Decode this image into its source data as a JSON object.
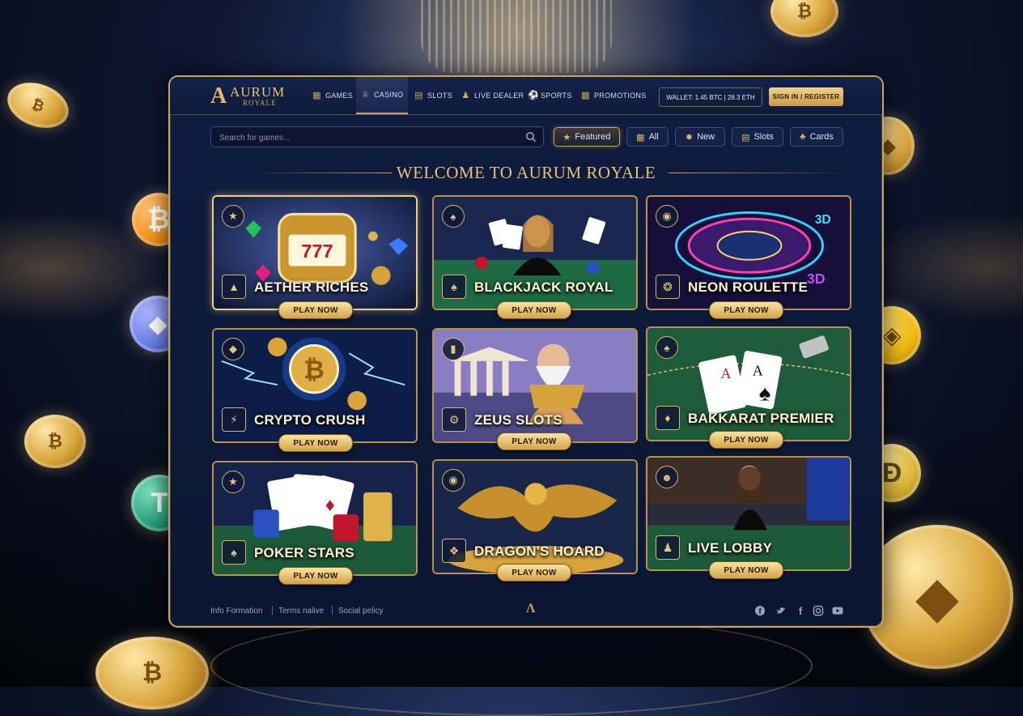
{
  "header": {
    "logo_mark": "A",
    "logo_name": "AURUM",
    "logo_sub": "ROYALE",
    "nav": [
      {
        "label": "GAMES",
        "icon": "grid-icon"
      },
      {
        "label": "CASINO",
        "icon": "crown-icon",
        "active": true
      },
      {
        "label": "SLOTS",
        "icon": "slot-machine-icon"
      },
      {
        "label": "LIVE DEALER",
        "icon": "person-icon"
      },
      {
        "label": "SPORTS",
        "icon": "soccer-ball-icon"
      },
      {
        "label": "PROMOTIONS",
        "icon": "gift-icon"
      }
    ],
    "wallet": "WALLET: 1.45 BTC | 28.3 ETH",
    "signin": "SIGN IN / REGISTER"
  },
  "search": {
    "placeholder": "Search for games..."
  },
  "filters": [
    {
      "label": "Featured",
      "icon": "star-icon",
      "active": true
    },
    {
      "label": "All",
      "icon": "grid-icon"
    },
    {
      "label": "New",
      "icon": "badge-icon"
    },
    {
      "label": "Slots",
      "icon": "slot-machine-icon"
    },
    {
      "label": "Cards",
      "icon": "cards-icon"
    }
  ],
  "welcome": "WELCOME TO AURUM ROYALE",
  "games": [
    {
      "title": "AETHER RICHES",
      "cta": "PLAY NOW"
    },
    {
      "title": "BLACKJACK ROYAL",
      "cta": "PLAY NOW"
    },
    {
      "title": "NEON ROULETTE",
      "cta": "PLAY NOW"
    },
    {
      "title": "CRYPTO CRUSH",
      "cta": "PLAY NOW"
    },
    {
      "title": "ZEUS SLOTS",
      "cta": "PLAY NOW"
    },
    {
      "title": "BAKKARAT PREMIER",
      "cta": "PLAY NOW"
    },
    {
      "title": "POKER STARS",
      "cta": "PLAY NOW"
    },
    {
      "title": "DRAGON'S HOARD",
      "cta": "PLAY NOW"
    },
    {
      "title": "LIVE LOBBY",
      "cta": "PLAY NOW"
    }
  ],
  "footer": {
    "links": [
      "Info Formation",
      "Terms nalive",
      "Social pelicy"
    ],
    "social": [
      "facebook-icon",
      "twitter-icon",
      "facebook-f-icon",
      "instagram-icon",
      "youtube-icon"
    ]
  },
  "colors": {
    "gold": "#c9a45a",
    "navy": "#0f1c3e",
    "text": "#fff3d4"
  }
}
